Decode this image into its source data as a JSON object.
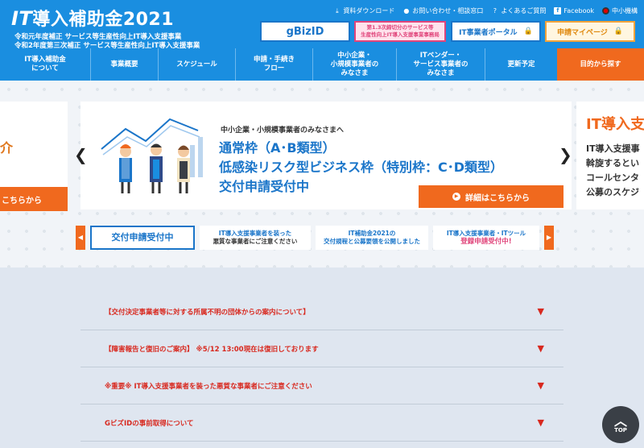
{
  "header": {
    "logo_it": "IT",
    "logo_rest": "導入補助金2021",
    "sub_line1": "令和元年度補正 サービス等生産性向上IT導入支援事業",
    "sub_line2": "令和2年度第三次補正 サービス等生産性向上IT導入支援事業",
    "top_links": [
      {
        "label": "資料ダウンロード",
        "icon": "download-icon",
        "glyph": "⤓"
      },
      {
        "label": "お問い合わせ・相談窓口",
        "icon": "person-icon",
        "glyph": "●"
      },
      {
        "label": "よくあるご質問",
        "icon": "question-icon",
        "glyph": "?"
      },
      {
        "label": "Facebook",
        "icon": "facebook-icon",
        "glyph": "f"
      },
      {
        "label": "中小機構",
        "icon": "smrj-flag-icon",
        "glyph": ""
      }
    ],
    "banners": {
      "gbiz": "gBizID",
      "pink_line1": "第1.3次締切分のサービス等",
      "pink_line2": "生産性向上IT導入支援事業事務局",
      "portal": "IT事業者ポータル",
      "mypage": "申請マイページ"
    },
    "nav": [
      {
        "line1": "IT導入補助金",
        "line2": "について"
      },
      {
        "line1": "事業概要",
        "line2": ""
      },
      {
        "line1": "スケジュール",
        "line2": ""
      },
      {
        "line1": "申請・手続き",
        "line2": "フロー"
      },
      {
        "line1": "中小企業・",
        "line2": "小規模事業者の",
        "line3": "みなさま"
      },
      {
        "line1": "ITベンダー・",
        "line2": "サービス事業者の",
        "line3": "みなさま"
      },
      {
        "line1": "更新予定",
        "line2": ""
      },
      {
        "line1": "目的から探す",
        "line2": ""
      }
    ]
  },
  "hero": {
    "left_intro": "介",
    "left_cta": "こちらから",
    "slide_sub": "中小企業・小規模事業者のみなさまへ",
    "slide_line1": "通常枠（A･B類型）",
    "slide_line2": "低感染リスク型ビジネス枠（特別枠：C･D類型）",
    "slide_line3": "交付申請受付中",
    "slide_cta": "詳細はこちらから",
    "right_title": "IT導入支",
    "right_lines": [
      "IT導入支援事",
      "斡旋するとい",
      "コールセンタ",
      "公募のスケジ"
    ],
    "prev_arrow": "❮",
    "next_arrow": "❯",
    "thumbs": {
      "t1": "交付申請受付中",
      "t2_line1": "IT導入支援事業者を装った",
      "t2_line2": "悪質な事業者にご注意ください",
      "t3_line1": "IT補助金2021の",
      "t3_line2": "交付規程と公募要領を公開しました",
      "t4_line1": "IT導入支援事業者・ITツール",
      "t4_line2": "登録申請受付中!"
    }
  },
  "notices": [
    {
      "text": "【交付決定事業者等に対する所属不明の団体からの案内について】",
      "color": "#d8281e"
    },
    {
      "text": "【障害報告と復旧のご案内】 ※5/12 13:00現在は復旧しております",
      "color": "#d8281e"
    },
    {
      "text": "※重要※ IT導入支援事業者を装った悪質な事業者にご注意ください",
      "color": "#d8281e"
    },
    {
      "text": "GビズIDの事前取得について",
      "color": "#d8281e"
    }
  ],
  "top_button": "TOP",
  "colors": {
    "brand": "#1a8ee0",
    "accent": "#f0691e",
    "link": "#1a75c9"
  }
}
